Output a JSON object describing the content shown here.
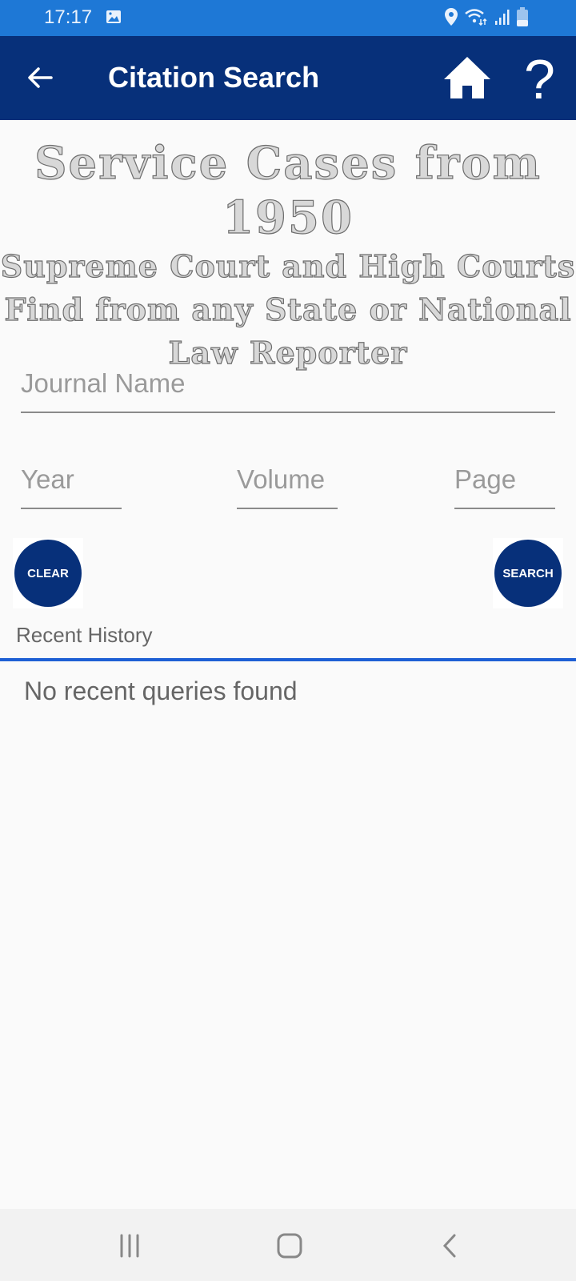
{
  "status_bar": {
    "time": "17:17",
    "icons": [
      "gallery-icon",
      "location-icon",
      "wifi-icon",
      "signal-icon",
      "battery-icon"
    ]
  },
  "app_bar": {
    "title": "Citation Search",
    "back_icon": "arrow-left-icon",
    "home_icon": "home-icon",
    "help_label": "?"
  },
  "banner": {
    "line1": "Service Cases from 1950",
    "line2": "Supreme Court and High Courts",
    "line3": "Find from any State or National",
    "line4": "Law Reporter"
  },
  "form": {
    "journal_placeholder": "Journal Name",
    "journal_value": "",
    "year_placeholder": "Year",
    "year_value": "",
    "volume_placeholder": "Volume",
    "volume_value": "",
    "page_placeholder": "Page",
    "page_value": "",
    "clear_label": "CLEAR",
    "search_label": "SEARCH"
  },
  "history": {
    "label": "Recent History",
    "empty_message": "No recent queries found"
  },
  "colors": {
    "status_bar": "#1e78d6",
    "app_bar": "#07307a",
    "accent_divider": "#1e5fd4"
  }
}
